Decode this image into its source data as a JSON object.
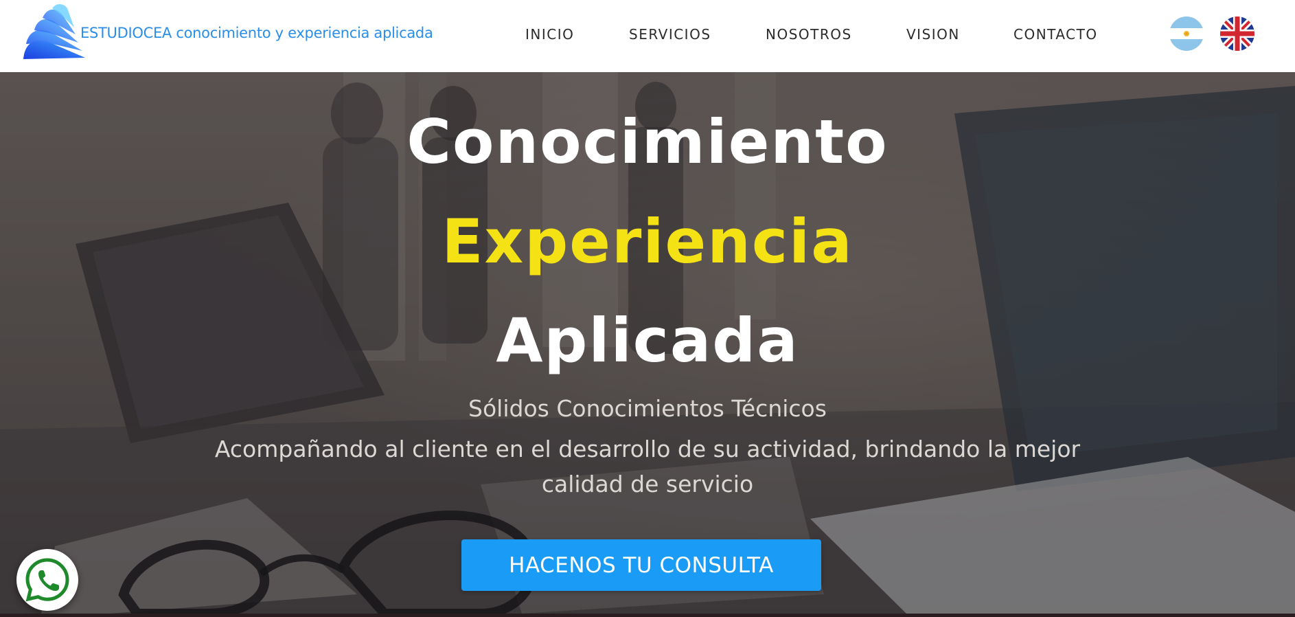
{
  "brand": {
    "text": "ESTUDIOCEA conocimiento y experiencia aplicada",
    "logo_icon": "wing-logo-icon",
    "color": "#2a8ee8"
  },
  "nav": {
    "items": [
      {
        "label": "INICIO"
      },
      {
        "label": "SERVICIOS"
      },
      {
        "label": "NOSOTROS"
      },
      {
        "label": "VISION"
      },
      {
        "label": "CONTACTO"
      }
    ]
  },
  "languages": [
    {
      "icon": "argentina-flag-icon"
    },
    {
      "icon": "uk-flag-icon"
    }
  ],
  "hero": {
    "line1": "Conocimiento",
    "line2": "Experiencia",
    "line3": "Aplicada",
    "subtitle": "Sólidos Conocimientos Técnicos",
    "description": "Acompañando al cliente en el desarrollo de su actividad, brindando la mejor calidad de servicio",
    "cta_label": "HACENOS TU CONSULTA",
    "accent_color": "#f5e214",
    "cta_color": "#1a9bf5"
  },
  "floating": {
    "whatsapp_icon": "whatsapp-icon"
  }
}
